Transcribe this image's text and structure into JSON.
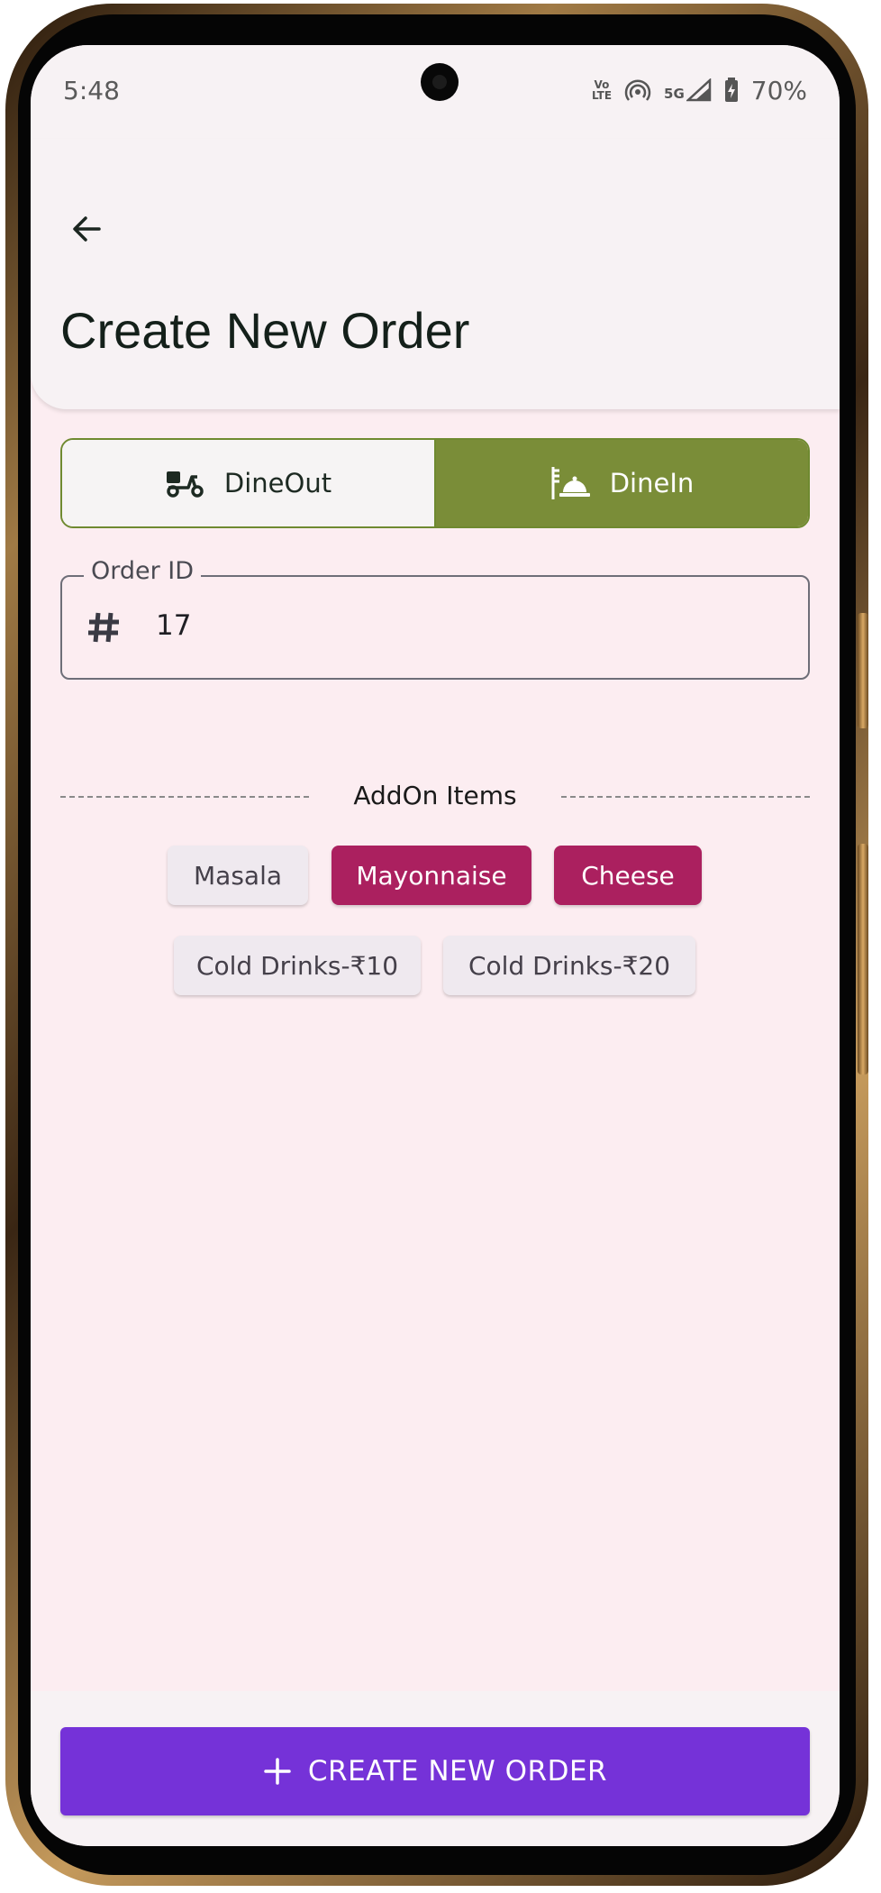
{
  "status_bar": {
    "time": "5:48",
    "volte_line1": "Vo",
    "volte_line2": "LTE",
    "network": "5G",
    "battery": "70%",
    "icons": [
      "volte-icon",
      "hotspot-icon",
      "signal-icon",
      "battery-charging-icon"
    ]
  },
  "app_bar": {
    "back_icon": "arrow-back-icon",
    "title": "Create New Order"
  },
  "order_type": {
    "options": [
      {
        "label": "DineOut",
        "icon": "scooter-delivery-icon",
        "selected": false
      },
      {
        "label": "DineIn",
        "icon": "dining-cloche-icon",
        "selected": true
      }
    ],
    "selected_color": "#7a8d38"
  },
  "order_id": {
    "label": "Order ID",
    "value": "17",
    "icon": "hash-icon"
  },
  "addons": {
    "title": "AddOn Items",
    "items": [
      {
        "label": "Masala",
        "selected": false
      },
      {
        "label": "Mayonnaise",
        "selected": true
      },
      {
        "label": "Cheese",
        "selected": true
      },
      {
        "label": "Cold Drinks-₹10",
        "selected": false
      },
      {
        "label": "Cold Drinks-₹20",
        "selected": false
      }
    ],
    "selected_color": "#ab205f"
  },
  "create_button": {
    "label": "CREATE NEW ORDER",
    "icon": "plus-icon",
    "color": "#7532d8"
  }
}
